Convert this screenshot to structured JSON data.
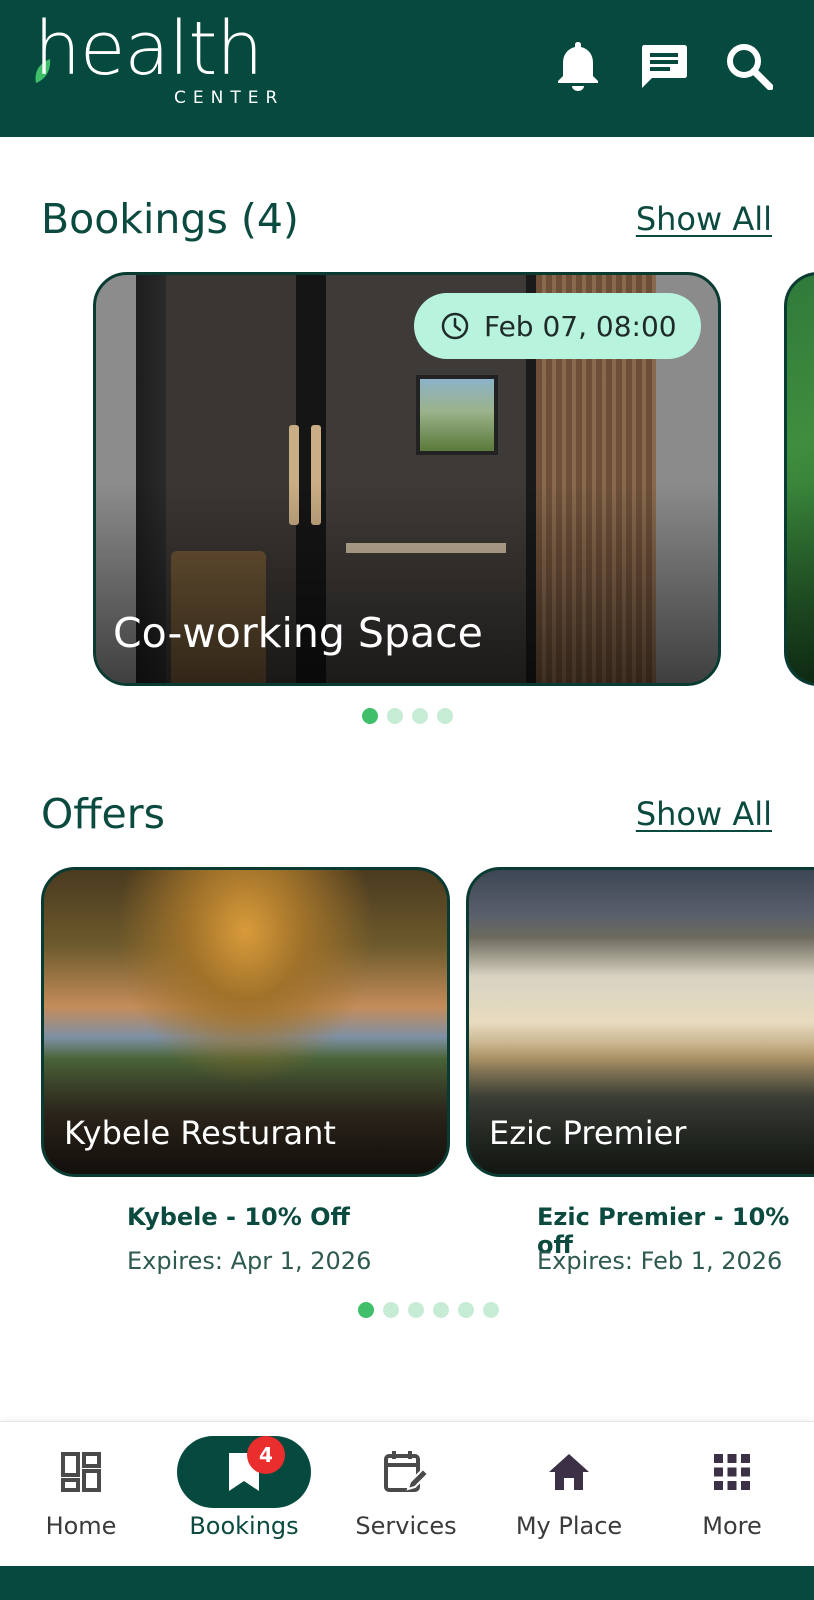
{
  "header": {
    "logo_word": "health",
    "logo_sub": "CENTER",
    "icons": [
      "bell-icon",
      "message-icon",
      "search-icon"
    ],
    "bg_color": "#064a3f"
  },
  "bookings": {
    "title": "Bookings (4)",
    "show_all": "Show All",
    "cards": [
      {
        "name": "Co-working Space",
        "date": "Feb 07, 08:00"
      }
    ],
    "page_count": 4,
    "active_page": 1
  },
  "offers": {
    "title": "Offers",
    "show_all": "Show All",
    "cards": [
      {
        "name": "Kybele Resturant",
        "offer": "Kybele - 10% Off",
        "expires": "Expires: Apr 1, 2026"
      },
      {
        "name": "Ezic Premier",
        "offer": "Ezic Premier - 10% off",
        "expires": "Expires: Feb 1, 2026"
      }
    ],
    "page_count": 6,
    "active_page": 1
  },
  "nav": {
    "items": [
      {
        "label": "Home",
        "icon": "dashboard-icon"
      },
      {
        "label": "Bookings",
        "icon": "bookmark-icon",
        "badge": "4",
        "active": true
      },
      {
        "label": "Services",
        "icon": "calendar-edit-icon"
      },
      {
        "label": "My Place",
        "icon": "house-icon"
      },
      {
        "label": "More",
        "icon": "grid-icon"
      }
    ]
  },
  "colors": {
    "primary": "#064a3f",
    "accent_pill": "#b8f3dd",
    "dot_active": "#3fbf6a",
    "dot_inactive": "#c7ecd5",
    "badge": "#ea2e2e"
  }
}
